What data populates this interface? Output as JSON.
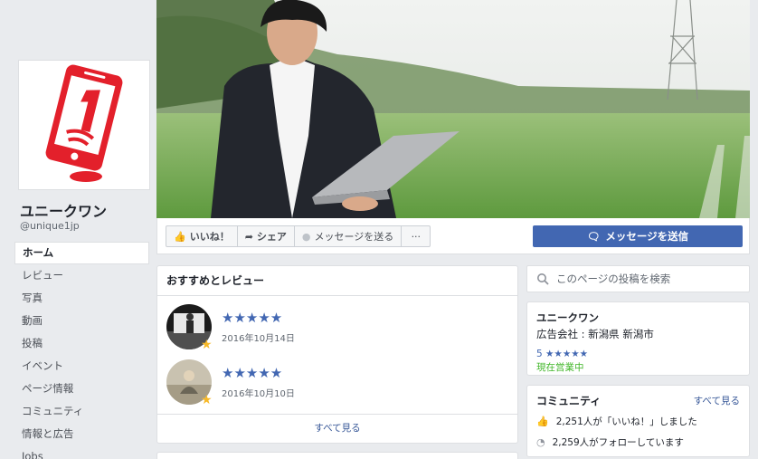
{
  "page": {
    "name": "ユニークワン",
    "handle": "@unique1jp"
  },
  "nav": [
    {
      "label": "ホーム",
      "active": true
    },
    {
      "label": "レビュー"
    },
    {
      "label": "写真"
    },
    {
      "label": "動画"
    },
    {
      "label": "投稿"
    },
    {
      "label": "イベント"
    },
    {
      "label": "ページ情報"
    },
    {
      "label": "コミュニティ"
    },
    {
      "label": "情報と広告"
    },
    {
      "label": "Jobs"
    }
  ],
  "actions": {
    "like": "いいね！",
    "share": "シェア",
    "message": "メッセージを送る",
    "more": "···",
    "send_message": "メッセージを送信"
  },
  "reviews": {
    "title": "おすすめとレビュー",
    "items": [
      {
        "stars": "★★★★★",
        "date": "2016年10月14日"
      },
      {
        "stars": "★★★★★",
        "date": "2016年10月10日"
      }
    ],
    "see_all": "すべて見る"
  },
  "search": {
    "placeholder": "このページの投稿を検索"
  },
  "info": {
    "name": "ユニークワン",
    "category": "広告会社 : 新潟県 新潟市",
    "rating": "5 ★★★★★",
    "status": "現在営業中"
  },
  "community": {
    "title": "コミュニティ",
    "see_all": "すべて見る",
    "likes": "2,251人が「いいね！」しました",
    "follows": "2,259人がフォローしています"
  },
  "colors": {
    "brand": "#4267b2",
    "logo_red": "#e3202b",
    "open": "#42b72a"
  }
}
